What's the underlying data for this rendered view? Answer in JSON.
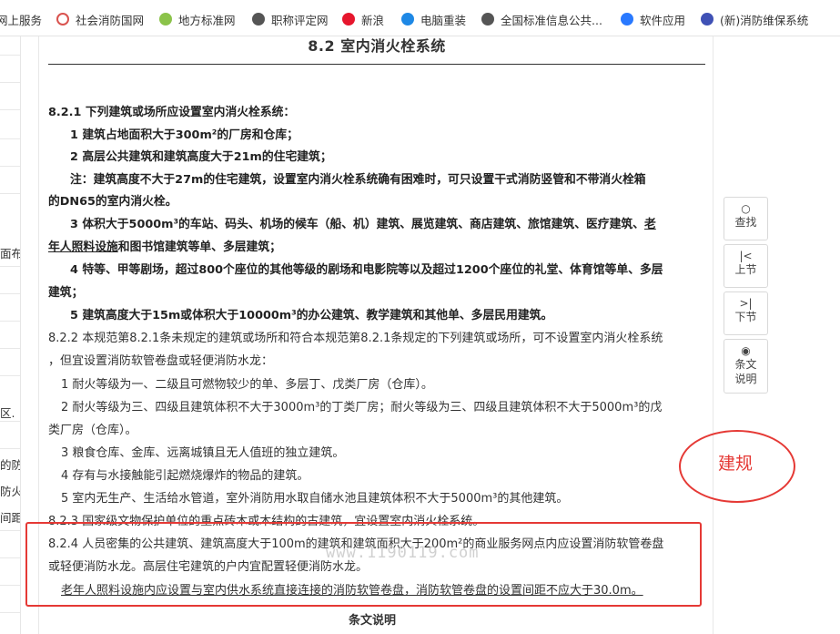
{
  "bookmarks": [
    {
      "label": "网上服务",
      "icon": "none"
    },
    {
      "label": "社会消防国网",
      "icon": "shield-icon"
    },
    {
      "label": "地方标准网",
      "icon": "leaf-icon"
    },
    {
      "label": "职称评定网",
      "icon": "globe-icon"
    },
    {
      "label": "新浪",
      "icon": "weibo-icon"
    },
    {
      "label": "电脑重装",
      "icon": "computer-icon"
    },
    {
      "label": "全国标准信息公共...",
      "icon": "globe-icon"
    },
    {
      "label": "软件应用",
      "icon": "app-icon"
    },
    {
      "label": "(新)消防维保系统",
      "icon": "gear-icon"
    }
  ],
  "sidebar_fragments": [
    "面布",
    "区.",
    "的防",
    "防火",
    "间距"
  ],
  "section_title": "8.2 室内消火栓系统",
  "paragraphs": [
    "8.2.1 下列建筑或场所应设置室内消火栓系统：",
    "1 建筑占地面积大于300m²的厂房和仓库；",
    "2 高层公共建筑和建筑高度大于21m的住宅建筑；",
    "注：建筑高度不大于27m的住宅建筑，设置室内消火栓系统确有困难时，可只设置干式消防竖管和不带消火栓箱",
    "的DN65的室内消火栓。",
    "3 体积大于5000m³的车站、码头、机场的候车（船、机）建筑、展览建筑、商店建筑、旅馆建筑、医疗建筑、",
    "老",
    "年人照料设施",
    "和图书馆建筑等单、多层建筑；",
    "4 特等、甲等剧场，超过800个座位的其他等级的剧场和电影院等以及超过1200个座位的礼堂、体育馆等单、多层",
    "建筑；",
    "5 建筑高度大于15m或体积大于10000m³的办公建筑、教学建筑和其他单、多层民用建筑。",
    "8.2.2 本规范第8.2.1条未规定的建筑或场所和符合本规范第8.2.1条规定的下列建筑或场所，可不设置室内消火栓系统",
    "，但宜设置消防软管卷盘或轻便消防水龙：",
    "1 耐火等级为一、二级且可燃物较少的单、多层丁、戊类厂房（仓库）。",
    "2 耐火等级为三、四级且建筑体积不大于3000m³的丁类厂房；耐火等级为三、四级且建筑体积不大于5000m³的戊",
    "类厂房（仓库）。",
    "3 粮食仓库、金库、远离城镇且无人值班的独立建筑。",
    "4 存有与水接触能引起燃烧爆炸的物品的建筑。",
    "5 室内无生产、生活给水管道，室外消防用水取自储水池且建筑体积不大于5000m³的其他建筑。",
    "8.2.3 国家级文物保护单位的重点砖木或木结构的古建筑，宜设置室内消火栓系统。",
    "8.2.4 人员密集的公共建筑、建筑高度大于100m的建筑和建筑面积大于200m²的商业服务网点内应设置消防软管卷盘",
    "或轻便消防水龙。高层住宅建筑的户内宜配置轻便消防水龙。",
    "老年人照料设施内应设置与室内供水系统直接连接的消防软管卷盘，消防软管卷盘的设置间距不应大于30.0m。"
  ],
  "watermark": "www.1190119.com",
  "footer_label": "条文说明",
  "toolbar": [
    {
      "icon": "search-icon",
      "glyph": "○",
      "label": "查找"
    },
    {
      "icon": "prev-section-icon",
      "glyph": "|<",
      "label": "上节"
    },
    {
      "icon": "next-section-icon",
      "glyph": ">|",
      "label": "下节"
    },
    {
      "icon": "eye-icon",
      "glyph": "◉",
      "label": "条文",
      "label2": "说明"
    }
  ],
  "annotation": {
    "text": "建规",
    "color": "#e53935"
  },
  "colors": {
    "highlight_box": "#e53935",
    "text": "#333333"
  }
}
